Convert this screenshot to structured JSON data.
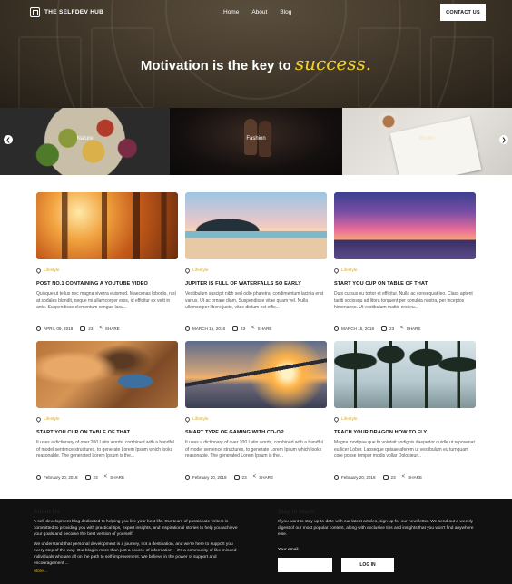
{
  "header": {
    "logo_text": "THE SELFDEV HUB",
    "nav": [
      "Home",
      "About",
      "Blog"
    ],
    "contact_label": "CONTACT US"
  },
  "hero": {
    "title_main": "Motivation is the key to",
    "title_accent": "success."
  },
  "categories": [
    "Nature",
    "Fashion",
    "Books"
  ],
  "carousel": {
    "prev_icon": "chevron-left-icon",
    "next_icon": "chevron-right-icon"
  },
  "posts": [
    {
      "category": "Lifestyle",
      "title": "POST NO.1 CONTAINING A YOUTUBE VIDEO",
      "excerpt": "Quisque ut tellus nec magna viverra euismod. Maecenas lobortis, nisl at sodales blandit, neque mi ullamcorper eros, id efficitur ex velit in ante. Suspendisse elementum congue lacu...",
      "date": "APRIL 09, 2018",
      "comments": "23",
      "share": "SHARE"
    },
    {
      "category": "Lifestyle",
      "title": "JUPITER IS FULL OF WATERFALLS SO EARLY",
      "excerpt": "Vestibulum suscipit nibh sed odio pharetra, condimentum lacinia erat varius. Ut ac ornare diam. Suspendisse vitae quam vel. Nulla ullamcorper libero justo, vitae dictum est effic...",
      "date": "MARCH 15, 2018",
      "comments": "23",
      "share": "SHARE"
    },
    {
      "category": "Lifestyle",
      "title": "START YOU CUP ON TABLE OF THAT",
      "excerpt": "Duis cursus eu tortor et efficitur. Nulla ac consequat leo. Class aptent taciti sociosqu ad litora torquent per conubia nostra, per inceptos himenaeos. Ut vestibulum mattis orci eu...",
      "date": "MARCH 15, 2018",
      "comments": "23",
      "share": "SHARE"
    },
    {
      "category": "Lifestyle",
      "title": "START YOU CUP ON TABLE OF THAT",
      "excerpt": "It uses a dictionary of over 200 Latin words, combined with a handful of model sentence structures, to generate Lorem Ipsum which looks reasonable. The generated Lorem Ipsum is the...",
      "date": "February 20, 2018",
      "comments": "23",
      "share": "SHARE"
    },
    {
      "category": "Lifestyle",
      "title": "SMART TYPE OF GAMING WITH CO-OP",
      "excerpt": "It uses a dictionary of over 200 Latin words, combined with a handful of model sentence structures, to generate Lorem Ipsum which looks reasonable. The generated Lorem Ipsum is the...",
      "date": "February 20, 2018",
      "comments": "23",
      "share": "SHARE"
    },
    {
      "category": "Lifestyle",
      "title": "TEACH YOUR DRAGON HOW TO FLY",
      "excerpt": "Magna modipae que fu volutatt sodignis daepedor quidle ut reposenat eu licer Lobor. Laoseque quisae aferem ut vestibulum eu turnquam core posse tempor modis vollar Dolosieur...",
      "date": "February 20, 2018",
      "comments": "23",
      "share": "SHARE"
    }
  ],
  "footer": {
    "about_title": "About Us",
    "about_p1": "A self-development blog dedicated to helping you live your best life. Our team of passionate writers is committed to providing you with practical tips, expert insights, and inspirational stories to help you achieve your goals and become the best version of yourself.",
    "about_p2": "We understand that personal development is a journey, not a destination, and we're here to support you every step of the way. Our blog is more than just a source of information – it's a community of like-minded individuals who are all on the path to self-improvement. We believe in the power of support and encouragement ...",
    "more_label": "More...",
    "stay_title": "Stay in touch",
    "stay_text": "If you want to stay up-to-date with our latest articles, sign up for our newsletter. We send out a weekly digest of our most popular content, along with exclusive tips and insights that you won't find anywhere else.",
    "email_label": "Your email",
    "email_value": "",
    "login_label": "LOG IN"
  },
  "colors": {
    "accent": "#f3d028",
    "category": "#d4a93a",
    "footer_bg": "#111111"
  }
}
